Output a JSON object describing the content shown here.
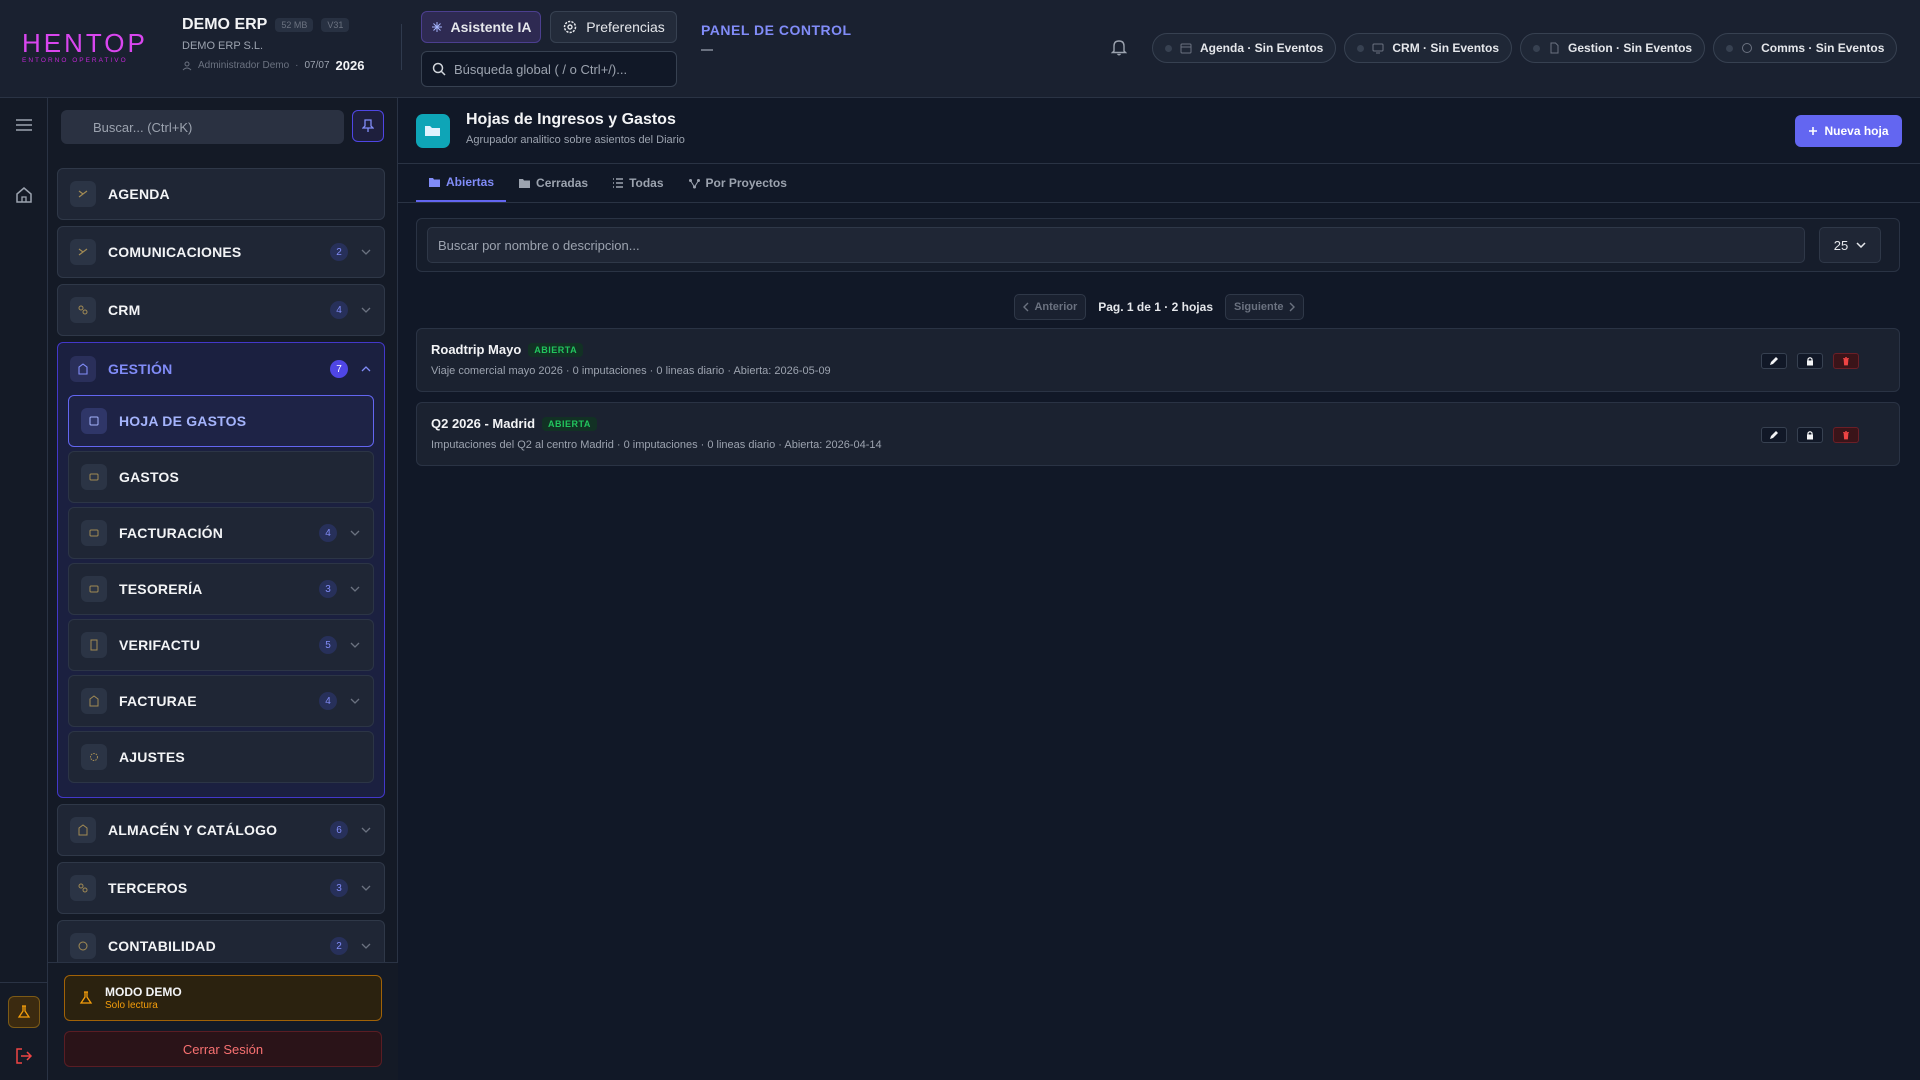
{
  "header": {
    "logo_text": "HENTOP",
    "logo_sub": "ENTORNO OPERATIVO",
    "org_name": "DEMO ERP",
    "size_badge": "52 MB",
    "version_badge": "V31",
    "company": "DEMO ERP S.L.",
    "user": "Administrador Demo",
    "date": "07/07",
    "year": "2026",
    "assistant_label": "Asistente IA",
    "preferences_label": "Preferencias",
    "search_placeholder": "Búsqueda global ( / o Ctrl+/)...",
    "panel_title": "PANEL DE CONTROL",
    "status": [
      {
        "label": "Agenda · Sin Eventos",
        "icon": "calendar-icon"
      },
      {
        "label": "CRM · Sin Eventos",
        "icon": "monitor-icon"
      },
      {
        "label": "Gestion · Sin Eventos",
        "icon": "document-icon"
      },
      {
        "label": "Comms · Sin Eventos",
        "icon": "chat-icon"
      }
    ]
  },
  "sidebar": {
    "search_placeholder": "Buscar... (Ctrl+K)",
    "items": [
      {
        "label": "AGENDA"
      },
      {
        "label": "COMUNICACIONES",
        "count": "2"
      },
      {
        "label": "CRM",
        "count": "4"
      }
    ],
    "open_group": {
      "label": "GESTIÓN",
      "count": "7",
      "children": [
        {
          "label": "HOJA DE GASTOS",
          "active": true
        },
        {
          "label": "GASTOS"
        },
        {
          "label": "FACTURACIÓN",
          "count": "4"
        },
        {
          "label": "TESORERÍA",
          "count": "3"
        },
        {
          "label": "VERIFACTU",
          "count": "5"
        },
        {
          "label": "FACTURAE",
          "count": "4"
        },
        {
          "label": "AJUSTES"
        }
      ]
    },
    "items_after": [
      {
        "label": "ALMACÉN Y CATÁLOGO",
        "count": "6"
      },
      {
        "label": "TERCEROS",
        "count": "3"
      },
      {
        "label": "CONTABILIDAD",
        "count": "2"
      }
    ],
    "demo_title": "MODO DEMO",
    "demo_sub": "Solo lectura",
    "logout_label": "Cerrar Sesión"
  },
  "main": {
    "title": "Hojas de Ingresos y Gastos",
    "subtitle": "Agrupador analitico sobre asientos del Diario",
    "new_button": "Nueva hoja",
    "tabs": [
      {
        "label": "Abiertas",
        "active": true
      },
      {
        "label": "Cerradas"
      },
      {
        "label": "Todas"
      },
      {
        "label": "Por Proyectos"
      }
    ],
    "filter_placeholder": "Buscar por nombre o descripcion...",
    "per_page": "25",
    "pager": {
      "prev": "Anterior",
      "info": "Pag. 1 de 1",
      "sep": "·",
      "count": "2 hojas",
      "next": "Siguiente"
    },
    "sheets": [
      {
        "name": "Roadtrip Mayo",
        "status": "ABIERTA",
        "meta": "Viaje comercial mayo 2026 · 0 imputaciones · 0 lineas diario · Abierta: 2026-05-09"
      },
      {
        "name": "Q2 2026 - Madrid",
        "status": "ABIERTA",
        "meta": "Imputaciones del Q2 al centro Madrid · 0 imputaciones · 0 lineas diario · Abierta: 2026-04-14"
      }
    ]
  }
}
